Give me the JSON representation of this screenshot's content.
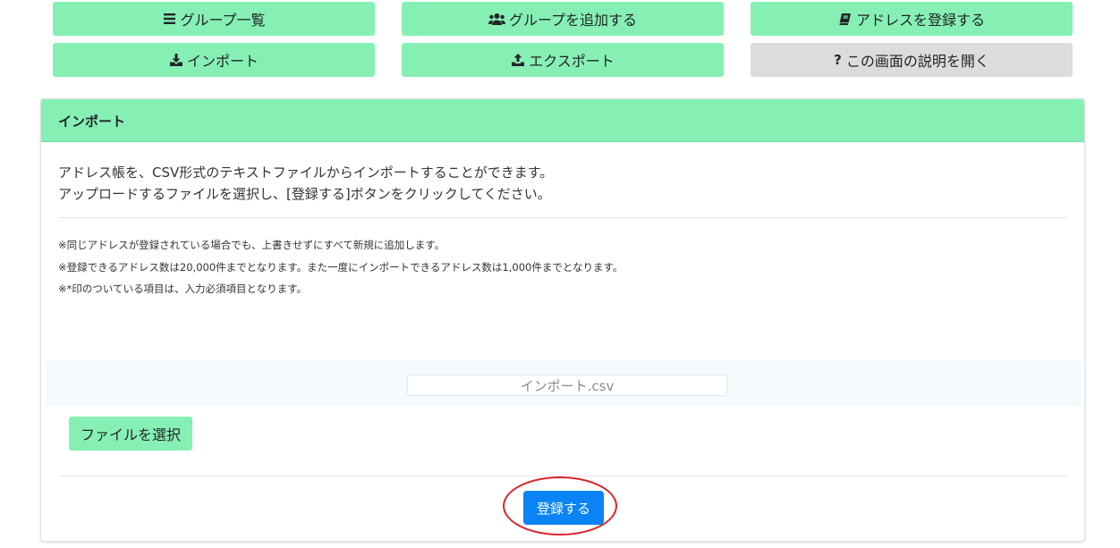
{
  "nav": {
    "group_list": "グループ一覧",
    "add_group": "グループを追加する",
    "register_address": "アドレスを登録する",
    "import": "インポート",
    "export": "エクスポート",
    "help": "この画面の説明を開く",
    "help_mark": "?"
  },
  "card": {
    "title": "インポート",
    "description": [
      "アドレス帳を、CSV形式のテキストファイルからインポートすることができます。",
      "アップロードするファイルを選択し、[登録する]ボタンをクリックしてください。"
    ],
    "notes": [
      "※同じアドレスが登録されている場合でも、上書きせずにすべて新規に追加します。",
      "※登録できるアドレス数は20,000件までとなります。また一度にインポートできるアドレス数は1,000件までとなります。",
      "※*印のついている項目は、入力必須項目となります。"
    ],
    "file_name": "インポート.csv",
    "select_file_label": "ファイルを選択",
    "submit_label": "登録する"
  },
  "colors": {
    "accent_green": "#86f0b4",
    "primary_blue": "#0a84f5",
    "neutral_gray": "#dcdcdc",
    "highlight_red": "#d9262c"
  },
  "icons": {
    "group_list": "list-icon",
    "add_group": "users-icon",
    "register_address": "book-icon",
    "import": "download-icon",
    "export": "upload-icon",
    "help": "question-icon"
  }
}
